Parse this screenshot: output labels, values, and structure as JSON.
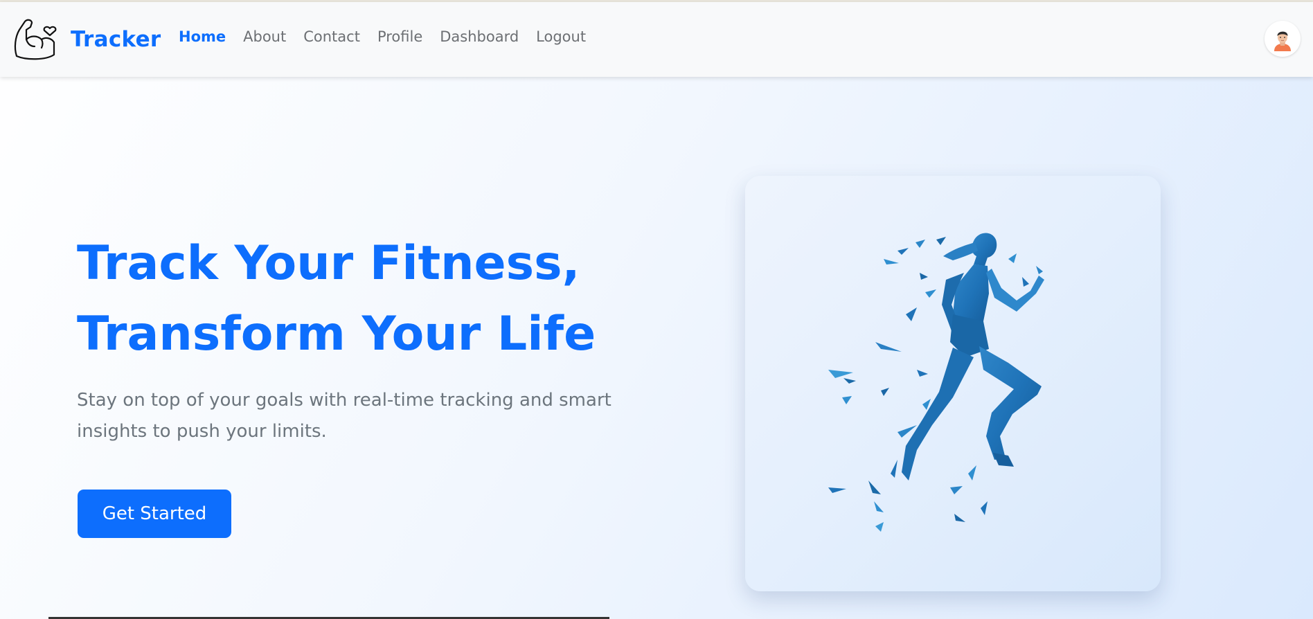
{
  "brand": {
    "name": "Tracker",
    "logo_icon": "flexed-arm-heart-icon"
  },
  "nav": {
    "links": [
      {
        "label": "Home",
        "active": true
      },
      {
        "label": "About",
        "active": false
      },
      {
        "label": "Contact",
        "active": false
      },
      {
        "label": "Profile",
        "active": false
      },
      {
        "label": "Dashboard",
        "active": false
      },
      {
        "label": "Logout",
        "active": false
      }
    ],
    "avatar_icon": "user-avatar-icon"
  },
  "hero": {
    "title_line1": "Track Your Fitness,",
    "title_line2": "Transform Your Life",
    "subtitle": "Stay on top of your goals with real-time tracking and smart insights to push your limits.",
    "cta_label": "Get Started",
    "image_icon": "low-poly-running-woman-illustration"
  },
  "colors": {
    "primary": "#0d6efd",
    "nav_text": "#6c6f73",
    "subtitle_text": "#6c757d",
    "navbar_bg": "#f8f9fa"
  }
}
